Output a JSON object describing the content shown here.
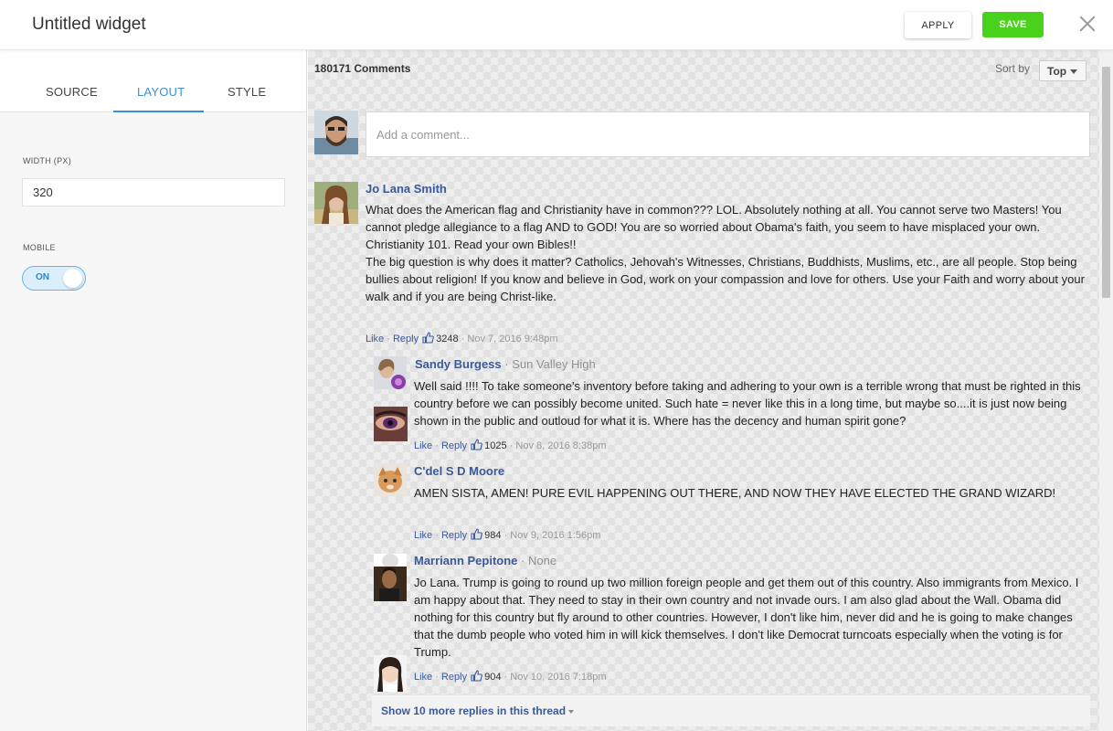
{
  "header": {
    "title": "Untitled widget",
    "apply_label": "APPLY",
    "save_label": "SAVE",
    "save_color": "#48d21b"
  },
  "sidebar": {
    "tabs": [
      {
        "label": "SOURCE"
      },
      {
        "label": "LAYOUT",
        "active": true
      },
      {
        "label": "STYLE"
      }
    ],
    "width_label": "WIDTH (PX)",
    "width_value": "320",
    "mobile_label": "MOBILE",
    "mobile_toggle": "ON",
    "accent_color": "#3d8fd3"
  },
  "preview": {
    "count_label": "180171 Comments",
    "sort_label": "Sort by",
    "sort_value": "Top",
    "comment_placeholder": "Add a comment...",
    "comments": [
      {
        "author": "Jo Lana Smith",
        "affiliation": "",
        "body": [
          "What does the American flag and Christianity have in common??? LOL. Absolutely nothing at all. You cannot serve two Masters! You cannot pledge allegiance to a flag AND to GOD! You are so worried about Obama's faith, you seem to have misplaced your own.",
          "Christianity 101. Read your own Bibles!!",
          "The big question is why does it matter? Catholics, Jehovah's Witnesses, Christians, Buddhists, Muslims, etc., are all people. Stop being bullies about religion! If you know and believe in God, work on your compassion and love for others. Use your Faith and worry about your walk and if you are being Christ-like."
        ],
        "like": "Like",
        "reply": "Reply",
        "likes": "3248",
        "time": "Nov 7, 2016 9:48pm"
      },
      {
        "author": "Sandy Burgess",
        "affiliation": "Sun Valley High",
        "body": "Well said !!!! To take someone's inventory before taking and adhering to your own is a terrible wrong that must be righted in this country before we can possibly become united. Such hate = never like this in a long time, but maybe so....it is just now being shown in the public and outloud for what it is. Where has the decency and human spirit gone?",
        "like": "Like",
        "reply": "Reply",
        "likes": "1025",
        "time": "Nov 8, 2016 8:38pm"
      },
      {
        "author": "C'del S D Moore",
        "affiliation": "",
        "body": "AMEN SISTA, AMEN! PURE EVIL HAPPENING OUT THERE, AND NOW THEY HAVE ELECTED THE GRAND WIZARD!",
        "like": "Like",
        "reply": "Reply",
        "likes": "984",
        "time": "Nov 9, 2016 1:56pm"
      },
      {
        "author": "Marriann Pepitone",
        "affiliation": "None",
        "body": "Jo Lana. Trump is going to round up two million foreign people and get them out of this country. Also immigrants from Mexico. I am happy about that. They need to stay in their own country and not invade ours. I am also glad about the Wall. Obama did nothing for this country but fly around to other countries. However, I don't like him, never did and he is going to make changes that the dumb people who voted him in will kick themselves. I don't like Democrat turncoats especially when the voting is for Trump.",
        "like": "Like",
        "reply": "Reply",
        "likes": "904",
        "time": "Nov 10, 2016 7:18pm"
      }
    ],
    "show_more": "Show 10 more replies in this thread",
    "link_color": "#3b5998"
  }
}
